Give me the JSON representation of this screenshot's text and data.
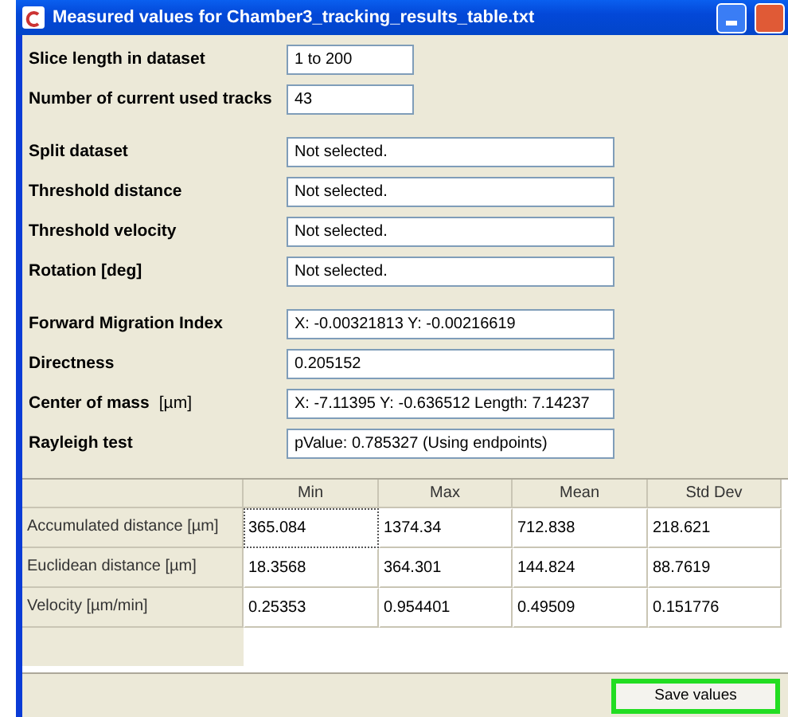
{
  "window": {
    "title": "Measured values for Chamber3_tracking_results_table.txt"
  },
  "field_groups": [
    [
      {
        "label": "Slice length in dataset",
        "value": "1 to 200",
        "kind": "short"
      },
      {
        "label": "Number of current used tracks",
        "value": "43",
        "kind": "short"
      }
    ],
    [
      {
        "label": "Split dataset",
        "value": "Not selected.",
        "kind": "wide"
      },
      {
        "label": "Threshold distance",
        "value": "Not selected.",
        "kind": "wide"
      },
      {
        "label": "Threshold velocity",
        "value": "Not selected.",
        "kind": "wide"
      },
      {
        "label": "Rotation [deg]",
        "value": "Not selected.",
        "kind": "wide"
      }
    ],
    [
      {
        "label": "Forward Migration Index",
        "value": "X: -0.00321813  Y: -0.00216619",
        "kind": "wide"
      },
      {
        "label": "Directness",
        "value": "0.205152",
        "kind": "wide"
      },
      {
        "label": "Center of mass",
        "unit": "[µm]",
        "value": "X: -7.11395  Y: -0.636512  Length: 7.14237",
        "kind": "wide"
      },
      {
        "label": "Rayleigh test",
        "value": "pValue: 0.785327 (Using endpoints)",
        "kind": "wide"
      }
    ]
  ],
  "table": {
    "columns": [
      "Min",
      "Max",
      "Mean",
      "Std Dev"
    ],
    "rows": [
      {
        "header": "Accumulated distance [µm]",
        "cells": [
          {
            "text": "365.084",
            "focused": true
          },
          {
            "text": "1374.34",
            "focused": false
          },
          {
            "text": "712.838",
            "focused": false
          },
          {
            "text": "218.621",
            "focused": false
          }
        ]
      },
      {
        "header": "Euclidean distance [µm]",
        "cells": [
          {
            "text": "18.3568",
            "focused": false
          },
          {
            "text": "364.301",
            "focused": false
          },
          {
            "text": "144.824",
            "focused": false
          },
          {
            "text": "88.7619",
            "focused": false
          }
        ]
      },
      {
        "header": "Velocity [µm/min]",
        "cells": [
          {
            "text": "0.25353",
            "focused": false
          },
          {
            "text": "0.954401",
            "focused": false
          },
          {
            "text": "0.49509",
            "focused": false
          },
          {
            "text": "0.151776",
            "focused": false
          }
        ]
      }
    ]
  },
  "save_button": {
    "label": "Save values",
    "highlighted": true
  }
}
